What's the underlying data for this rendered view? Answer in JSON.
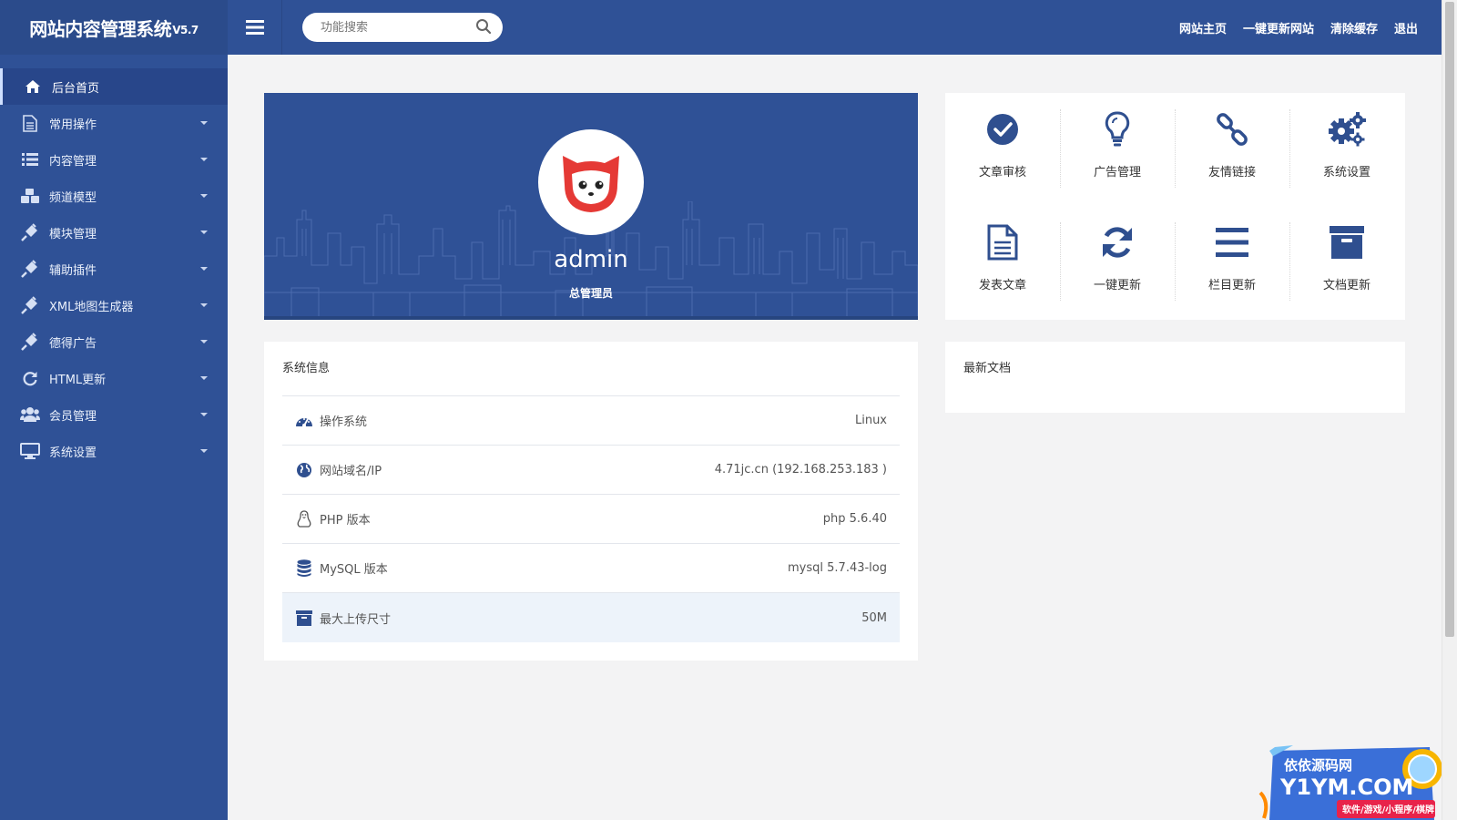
{
  "app": {
    "brand": "网站内容管理系统",
    "version": "V5.7"
  },
  "header": {
    "search_placeholder": "功能搜索",
    "links": [
      "网站主页",
      "一键更新网站",
      "清除缓存",
      "退出"
    ]
  },
  "sidebar": {
    "items": [
      {
        "label": "后台首页",
        "icon": "home-icon",
        "active": true
      },
      {
        "label": "常用操作",
        "icon": "file-icon"
      },
      {
        "label": "内容管理",
        "icon": "list-icon"
      },
      {
        "label": "频道模型",
        "icon": "cubes-icon"
      },
      {
        "label": "模块管理",
        "icon": "plug-icon"
      },
      {
        "label": "辅助插件",
        "icon": "plug-icon"
      },
      {
        "label": "XML地图生成器",
        "icon": "plug-icon"
      },
      {
        "label": "德得广告",
        "icon": "plug-icon"
      },
      {
        "label": "HTML更新",
        "icon": "refresh-icon"
      },
      {
        "label": "会员管理",
        "icon": "users-icon"
      },
      {
        "label": "系统设置",
        "icon": "desktop-icon"
      }
    ]
  },
  "profile": {
    "name": "admin",
    "role": "总管理员"
  },
  "quick": {
    "items": [
      {
        "label": "文章审核",
        "icon": "check-circle-icon"
      },
      {
        "label": "广告管理",
        "icon": "lightbulb-icon"
      },
      {
        "label": "友情链接",
        "icon": "link-icon"
      },
      {
        "label": "系统设置",
        "icon": "gears-icon"
      },
      {
        "label": "发表文章",
        "icon": "document-icon"
      },
      {
        "label": "一键更新",
        "icon": "refresh-icon"
      },
      {
        "label": "栏目更新",
        "icon": "bars-icon"
      },
      {
        "label": "文档更新",
        "icon": "archive-icon"
      }
    ]
  },
  "system_info": {
    "title": "系统信息",
    "rows": [
      {
        "label": "操作系统",
        "value": "Linux",
        "icon": "dashboard-icon"
      },
      {
        "label": "网站域名/IP",
        "value": "4.71jc.cn (192.168.253.183 )",
        "icon": "globe-icon"
      },
      {
        "label": "PHP 版本",
        "value": "php 5.6.40",
        "icon": "linux-icon"
      },
      {
        "label": "MySQL 版本",
        "value": "mysql 5.7.43-log",
        "icon": "database-icon"
      },
      {
        "label": "最大上传尺寸",
        "value": "50M",
        "icon": "archive-icon"
      }
    ]
  },
  "latest_docs": {
    "title": "最新文档"
  },
  "watermark": {
    "line1": "依依源码网",
    "line2": "Y1YM.COM",
    "line3": "软件/游戏/小程序/棋牌"
  },
  "colors": {
    "primary": "#2f5196",
    "sidebar_active": "#28468a",
    "background": "#f3f3f4",
    "icon_blue": "#2f4f8f"
  }
}
